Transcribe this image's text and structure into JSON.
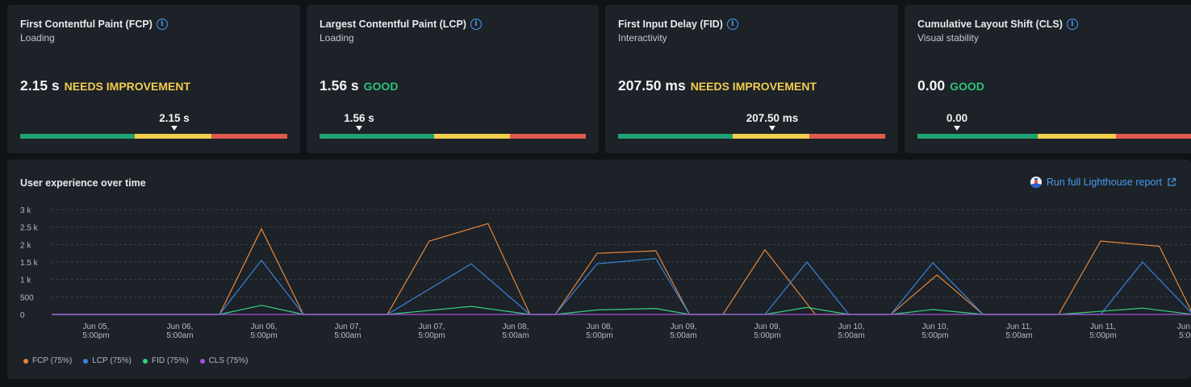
{
  "cards": [
    {
      "title": "First Contentful Paint (FCP)",
      "subtitle": "Loading",
      "value": "2.15 s",
      "status": "NEEDS IMPROVEMENT",
      "status_kind": "needs",
      "marker": "2.15 s",
      "marker_pos": 0.585
    },
    {
      "title": "Largest Contentful Paint (LCP)",
      "subtitle": "Loading",
      "value": "1.56 s",
      "status": "GOOD",
      "status_kind": "good",
      "marker": "1.56 s",
      "marker_pos": 0.15
    },
    {
      "title": "First Input Delay (FID)",
      "subtitle": "Interactivity",
      "value": "207.50 ms",
      "status": "NEEDS IMPROVEMENT",
      "status_kind": "needs",
      "marker": "207.50 ms",
      "marker_pos": 0.58
    },
    {
      "title": "Cumulative Layout Shift (CLS)",
      "subtitle": "Visual stability",
      "value": "0.00",
      "status": "GOOD",
      "status_kind": "good",
      "marker": "0.00",
      "marker_pos": 0.15
    }
  ],
  "panel": {
    "title": "User experience over time",
    "lighthouse_link": "Run full Lighthouse report"
  },
  "chart_data": {
    "type": "line",
    "title": "User experience over time",
    "y_ticks": [
      "0",
      "500",
      "1 k",
      "1.5 k",
      "2 k",
      "2.5 k",
      "3 k"
    ],
    "ylim": [
      0,
      3000
    ],
    "grid": true,
    "legend_position": "bottom-left",
    "x_ticks": [
      [
        "Jun 05,",
        "5:00pm"
      ],
      [
        "Jun 06,",
        "5:00am"
      ],
      [
        "Jun 06,",
        "5:00pm"
      ],
      [
        "Jun 07,",
        "5:00am"
      ],
      [
        "Jun 07,",
        "5:00pm"
      ],
      [
        "Jun 08,",
        "5:00am"
      ],
      [
        "Jun 08,",
        "5:00pm"
      ],
      [
        "Jun 09,",
        "5:00am"
      ],
      [
        "Jun 09,",
        "5:00pm"
      ],
      [
        "Jun 10,",
        "5:00am"
      ],
      [
        "Jun 10,",
        "5:00pm"
      ],
      [
        "Jun 11,",
        "5:00am"
      ],
      [
        "Jun 11,",
        "5:00pm"
      ],
      [
        "Jun 1",
        "5:00"
      ]
    ],
    "series": [
      {
        "name": "FCP (75%)",
        "color": "#e8853c",
        "points": [
          [
            0,
            0
          ],
          [
            2,
            0
          ],
          [
            2.5,
            2450
          ],
          [
            3,
            0
          ],
          [
            4,
            0
          ],
          [
            4.5,
            2100
          ],
          [
            5.2,
            2600
          ],
          [
            5.7,
            0
          ],
          [
            6,
            0
          ],
          [
            6.5,
            1750
          ],
          [
            7.2,
            1820
          ],
          [
            7.6,
            0
          ],
          [
            8,
            0
          ],
          [
            8.5,
            1850
          ],
          [
            9.1,
            0
          ],
          [
            10,
            0
          ],
          [
            10.55,
            1130
          ],
          [
            11.1,
            0
          ],
          [
            12,
            0
          ],
          [
            12.5,
            2100
          ],
          [
            13.2,
            1950
          ],
          [
            13.6,
            0
          ],
          [
            14,
            2500
          ]
        ]
      },
      {
        "name": "LCP (75%)",
        "color": "#3b82e0",
        "points": [
          [
            0,
            0
          ],
          [
            2,
            0
          ],
          [
            2.5,
            1550
          ],
          [
            3,
            0
          ],
          [
            4,
            0
          ],
          [
            5,
            1450
          ],
          [
            5.7,
            0
          ],
          [
            6,
            0
          ],
          [
            6.5,
            1450
          ],
          [
            7.2,
            1600
          ],
          [
            7.6,
            0
          ],
          [
            8.5,
            0
          ],
          [
            9,
            1500
          ],
          [
            9.5,
            0
          ],
          [
            10,
            0
          ],
          [
            10.5,
            1480
          ],
          [
            11.1,
            0
          ],
          [
            12,
            0
          ],
          [
            12.5,
            0
          ],
          [
            13,
            1500
          ],
          [
            13.6,
            0
          ],
          [
            14,
            1550
          ]
        ]
      },
      {
        "name": "FID (75%)",
        "color": "#36d27f",
        "points": [
          [
            0,
            0
          ],
          [
            2,
            0
          ],
          [
            2.5,
            260
          ],
          [
            3,
            0
          ],
          [
            4,
            0
          ],
          [
            5,
            230
          ],
          [
            5.7,
            0
          ],
          [
            6,
            0
          ],
          [
            6.5,
            130
          ],
          [
            7.2,
            170
          ],
          [
            7.6,
            0
          ],
          [
            8.5,
            0
          ],
          [
            9,
            200
          ],
          [
            9.5,
            0
          ],
          [
            10,
            0
          ],
          [
            10.5,
            140
          ],
          [
            11.1,
            0
          ],
          [
            12,
            0
          ],
          [
            13,
            180
          ],
          [
            13.6,
            0
          ],
          [
            14,
            200
          ]
        ]
      },
      {
        "name": "CLS (75%)",
        "color": "#a64de0",
        "points": [
          [
            0,
            0
          ],
          [
            14,
            0
          ]
        ]
      }
    ]
  }
}
